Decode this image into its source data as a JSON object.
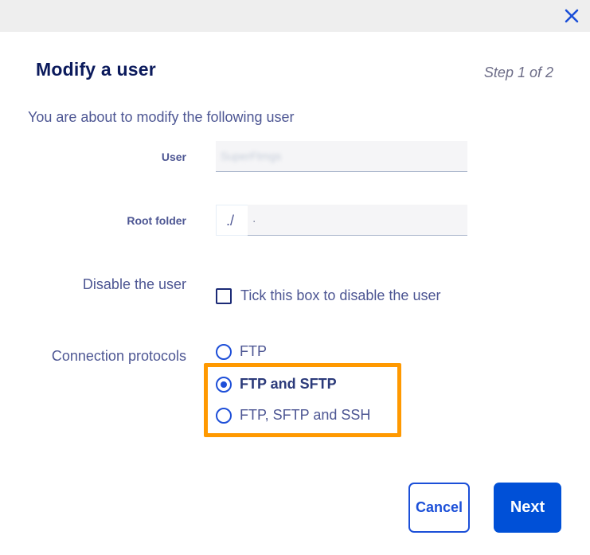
{
  "dialog": {
    "title": "Modify a user",
    "step": "Step 1 of 2",
    "intro": "You are about to modify the following user"
  },
  "form": {
    "user": {
      "label": "User",
      "value": "SuperFtmgs"
    },
    "root_folder": {
      "label": "Root folder",
      "prefix": "./",
      "value": "."
    },
    "disable": {
      "label": "Disable the user",
      "checkbox_label": "Tick this box to disable the user",
      "checked": false
    },
    "protocols": {
      "label": "Connection protocols",
      "options": [
        {
          "label": "FTP",
          "selected": false
        },
        {
          "label": "FTP and SFTP",
          "selected": true
        },
        {
          "label": "FTP, SFTP and SSH",
          "selected": false
        }
      ]
    }
  },
  "buttons": {
    "cancel": "Cancel",
    "next": "Next"
  },
  "colors": {
    "primary": "#0050d7",
    "highlight": "#ff9900",
    "text": "#4d5693"
  },
  "icons": {
    "close": "close-icon"
  }
}
